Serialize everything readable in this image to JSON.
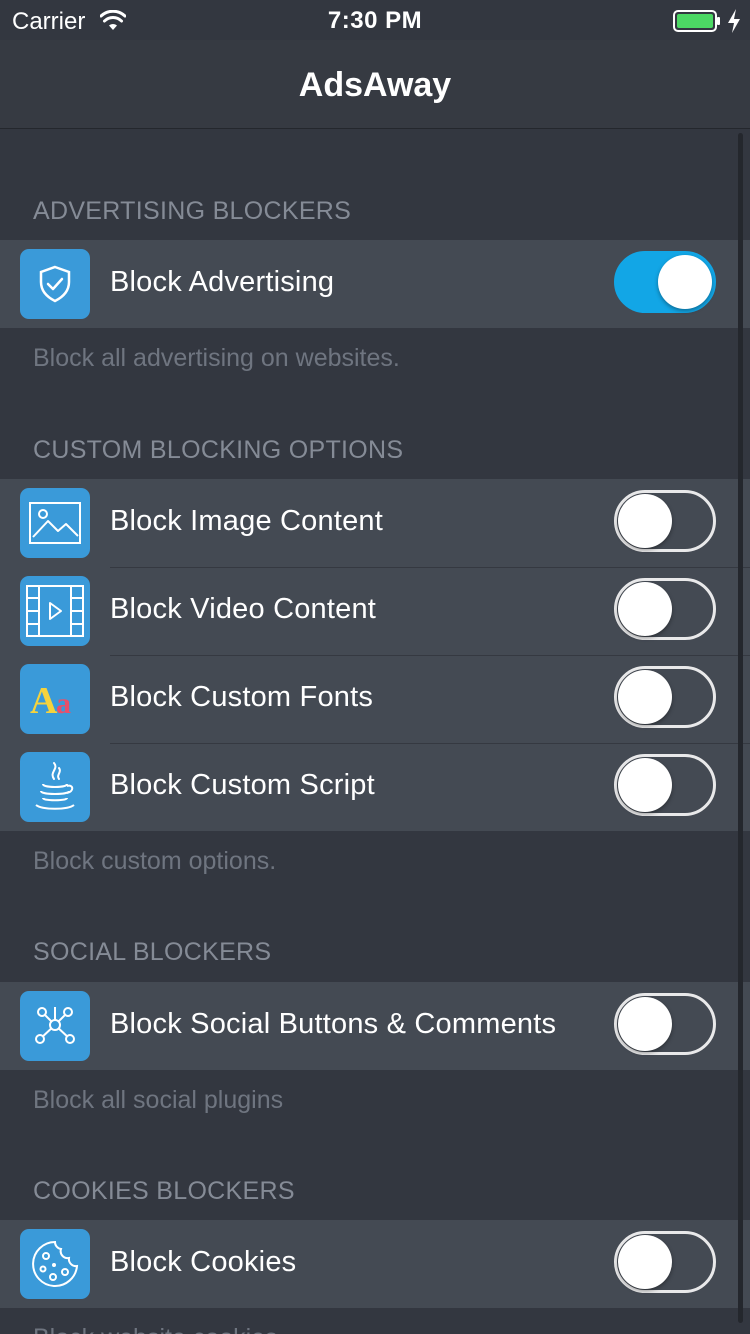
{
  "status_bar": {
    "carrier": "Carrier",
    "time": "7:30 PM",
    "battery_color": "#4cd964"
  },
  "nav": {
    "title": "AdsAway"
  },
  "sections": [
    {
      "header": "ADVERTISING BLOCKERS",
      "footer": "Block all advertising on websites.",
      "rows": [
        {
          "label": "Block Advertising",
          "icon": "shield-check-icon",
          "enabled": true
        }
      ]
    },
    {
      "header": "CUSTOM BLOCKING OPTIONS",
      "footer": "Block custom options.",
      "rows": [
        {
          "label": "Block Image Content",
          "icon": "image-icon",
          "enabled": false
        },
        {
          "label": "Block Video Content",
          "icon": "film-play-icon",
          "enabled": false
        },
        {
          "label": "Block Custom Fonts",
          "icon": "font-aa-icon",
          "enabled": false
        },
        {
          "label": "Block Custom Script",
          "icon": "java-cup-icon",
          "enabled": false
        }
      ]
    },
    {
      "header": "SOCIAL BLOCKERS",
      "footer": "Block all social plugins",
      "rows": [
        {
          "label": "Block Social Buttons & Comments",
          "icon": "network-share-icon",
          "enabled": false
        }
      ]
    },
    {
      "header": "COOKIES BLOCKERS",
      "footer": "Block website cookies",
      "rows": [
        {
          "label": "Block Cookies",
          "icon": "cookie-icon",
          "enabled": false
        }
      ]
    }
  ],
  "colors": {
    "background": "#333740",
    "cell": "#444a53",
    "accent": "#12a6e6",
    "icon_tile": "#3a9ad9"
  }
}
